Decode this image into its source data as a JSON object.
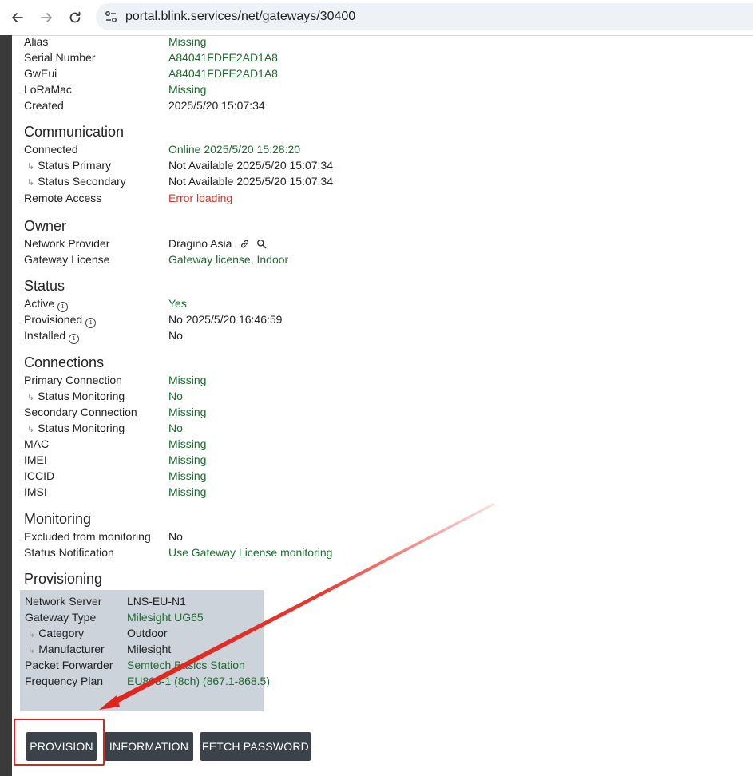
{
  "browser": {
    "url": "portal.blink.services/net/gateways/30400",
    "back_icon": "arrow-left-icon",
    "forward_icon": "arrow-right-icon",
    "reload_icon": "reload-icon",
    "site_info_icon": "tune-icon"
  },
  "general": [
    {
      "label": "Alias",
      "value": "Missing"
    },
    {
      "label": "Serial Number",
      "value": "A84041FDFE2AD1A8"
    },
    {
      "label": "GwEui",
      "value": "A84041FDFE2AD1A8"
    },
    {
      "label": "LoRaMac",
      "value": "Missing"
    },
    {
      "label": "Created",
      "value": "2025/5/20 15:07:34"
    }
  ],
  "communication": {
    "title": "Communication",
    "rows": [
      {
        "label": "Connected",
        "value": "Online 2025/5/20 15:28:20"
      },
      {
        "label": "Status Primary",
        "value": "Not Available 2025/5/20 15:07:34"
      },
      {
        "label": "Status Secondary",
        "value": "Not Available 2025/5/20 15:07:34"
      },
      {
        "label": "Remote Access",
        "value": "Error loading"
      }
    ]
  },
  "owner": {
    "title": "Owner",
    "rows": [
      {
        "label": "Network Provider",
        "value": "Dragino Asia"
      },
      {
        "label": "Gateway License",
        "value": "Gateway license, Indoor"
      }
    ]
  },
  "status": {
    "title": "Status",
    "rows": [
      {
        "label": "Active",
        "value": "Yes"
      },
      {
        "label": "Provisioned",
        "value": "No 2025/5/20 16:46:59"
      },
      {
        "label": "Installed",
        "value": "No"
      }
    ]
  },
  "connections": {
    "title": "Connections",
    "rows": [
      {
        "label": "Primary Connection",
        "value": "Missing"
      },
      {
        "label": "Status Monitoring",
        "value": "No"
      },
      {
        "label": "Secondary Connection",
        "value": "Missing"
      },
      {
        "label": "Status Monitoring",
        "value": "No"
      },
      {
        "label": "MAC",
        "value": "Missing"
      },
      {
        "label": "IMEI",
        "value": "Missing"
      },
      {
        "label": "ICCID",
        "value": "Missing"
      },
      {
        "label": "IMSI",
        "value": "Missing"
      }
    ]
  },
  "monitoring": {
    "title": "Monitoring",
    "rows": [
      {
        "label": "Excluded from monitoring",
        "value": "No"
      },
      {
        "label": "Status Notification",
        "value": "Use Gateway License monitoring"
      }
    ]
  },
  "provisioning": {
    "title": "Provisioning",
    "rows": [
      {
        "label": "Network Server",
        "value": "LNS-EU-N1"
      },
      {
        "label": "Gateway Type",
        "value": "Milesight UG65"
      },
      {
        "label": "Category",
        "value": "Outdoor"
      },
      {
        "label": "Manufacturer",
        "value": "Milesight"
      },
      {
        "label": "Packet Forwarder",
        "value": "Semtech Basics Station"
      },
      {
        "label": "Frequency Plan",
        "value": "EU868-1 (8ch) (867.1-868.5)"
      }
    ]
  },
  "buttons": {
    "provision": "PROVISION",
    "information": "INFORMATION",
    "fetch_password": "FETCH PASSWORD"
  },
  "sub_marker": "↳",
  "info_marker": "i",
  "colors": {
    "value_green": "#1e6b2f",
    "error_red": "#d7372b",
    "button_bg": "#3b4249",
    "provisioning_bg": "#ccd3db",
    "annotation_red": "#e2231a"
  }
}
